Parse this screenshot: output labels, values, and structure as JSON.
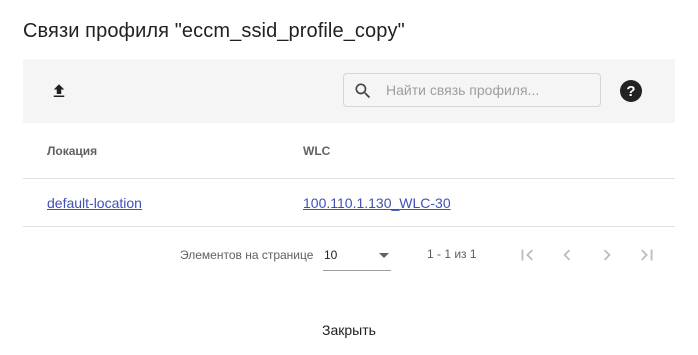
{
  "dialog": {
    "title": "Связи профиля \"eccm_ssid_profile_copy\""
  },
  "toolbar": {
    "upload_icon": "upload-icon",
    "search_icon": "search-icon",
    "search_placeholder": "Найти связь профиля...",
    "search_value": "",
    "help_icon": "help-icon",
    "help_glyph": "?"
  },
  "table": {
    "columns": [
      "Локация",
      "WLC"
    ],
    "rows": [
      {
        "location": "default-location",
        "wlc": "100.110.1.130_WLC-30"
      }
    ]
  },
  "paginator": {
    "page_size_label": "Элементов на странице",
    "page_size_value": "10",
    "range_label": "1 - 1 из 1",
    "first_icon": "first-page-icon",
    "prev_icon": "chevron-left-icon",
    "next_icon": "chevron-right-icon",
    "last_icon": "last-page-icon"
  },
  "actions": {
    "close_label": "Закрыть"
  },
  "colors": {
    "link": "#3f51b5",
    "toolbar_bg": "#f5f5f5",
    "divider": "#e0e0e0"
  }
}
